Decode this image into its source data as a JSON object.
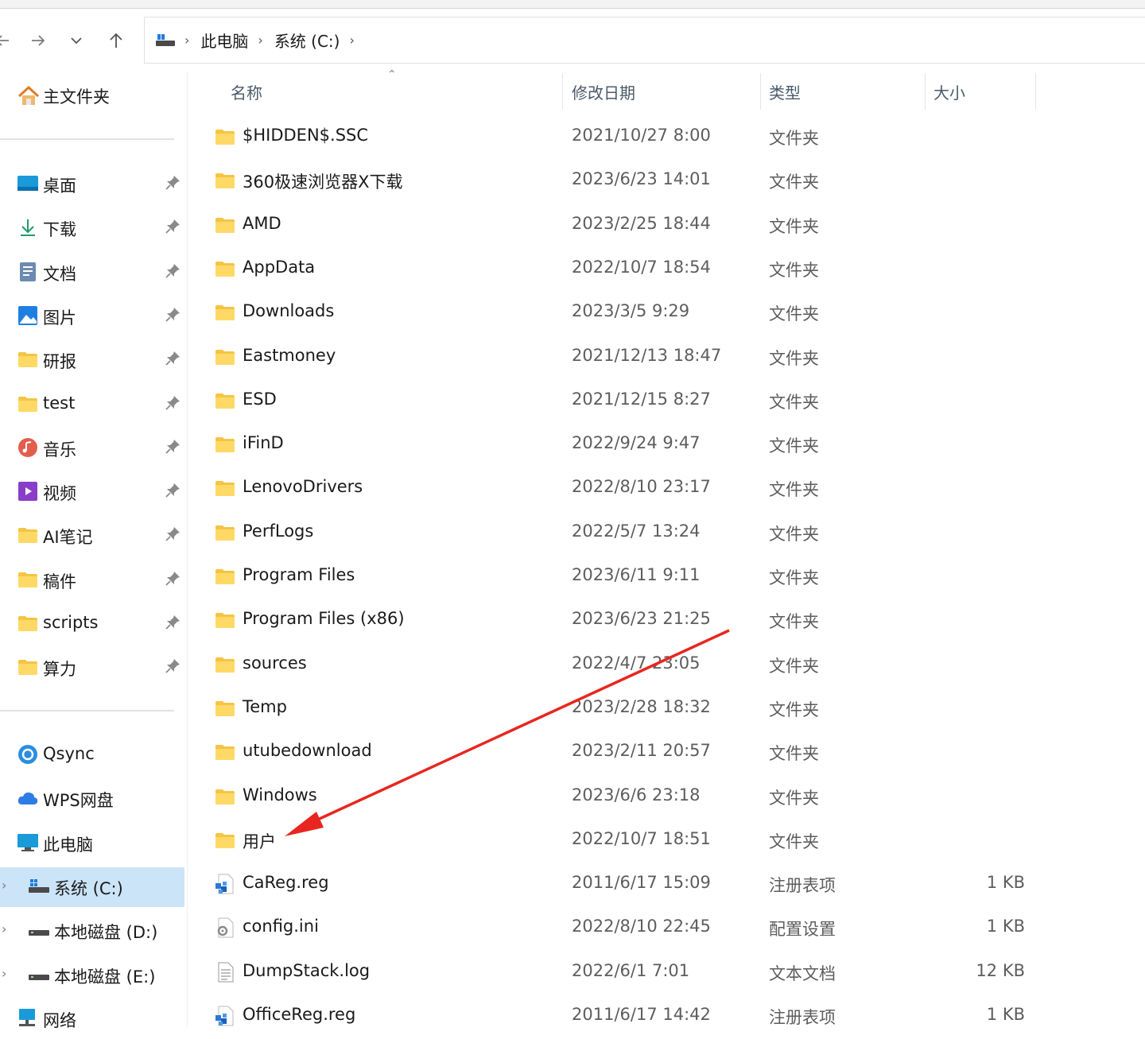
{
  "breadcrumb": [
    "此电脑",
    "系统 (C:)"
  ],
  "columns": {
    "name": "名称",
    "date": "修改日期",
    "type": "类型",
    "size": "大小"
  },
  "sidebar": {
    "home": "主文件夹",
    "pinned": [
      {
        "label": "桌面",
        "icon": "desktop-icon"
      },
      {
        "label": "下载",
        "icon": "download-icon"
      },
      {
        "label": "文档",
        "icon": "document-icon"
      },
      {
        "label": "图片",
        "icon": "pictures-icon"
      },
      {
        "label": "研报",
        "icon": "folder-icon"
      },
      {
        "label": "test",
        "icon": "folder-icon"
      },
      {
        "label": "音乐",
        "icon": "music-icon"
      },
      {
        "label": "视频",
        "icon": "video-icon"
      },
      {
        "label": "AI笔记",
        "icon": "folder-icon"
      },
      {
        "label": "稿件",
        "icon": "folder-icon"
      },
      {
        "label": "scripts",
        "icon": "folder-icon"
      },
      {
        "label": "算力",
        "icon": "folder-icon"
      }
    ],
    "locations": [
      {
        "label": "Qsync",
        "icon": "qsync-icon"
      },
      {
        "label": "WPS网盘",
        "icon": "cloud-icon"
      },
      {
        "label": "此电脑",
        "icon": "computer-icon"
      },
      {
        "label": "系统 (C:)",
        "icon": "drive-c-icon",
        "selected": true
      },
      {
        "label": "本地磁盘 (D:)",
        "icon": "drive-icon"
      },
      {
        "label": "本地磁盘 (E:)",
        "icon": "drive-icon"
      },
      {
        "label": "网络",
        "icon": "network-icon"
      }
    ]
  },
  "files": [
    {
      "name": "$HIDDEN$.SSC",
      "date": "2021/10/27 8:00",
      "type": "文件夹",
      "size": "",
      "icon": "folder"
    },
    {
      "name": "360极速浏览器X下载",
      "date": "2023/6/23 14:01",
      "type": "文件夹",
      "size": "",
      "icon": "folder"
    },
    {
      "name": "AMD",
      "date": "2023/2/25 18:44",
      "type": "文件夹",
      "size": "",
      "icon": "folder"
    },
    {
      "name": "AppData",
      "date": "2022/10/7 18:54",
      "type": "文件夹",
      "size": "",
      "icon": "folder"
    },
    {
      "name": "Downloads",
      "date": "2023/3/5 9:29",
      "type": "文件夹",
      "size": "",
      "icon": "folder"
    },
    {
      "name": "Eastmoney",
      "date": "2021/12/13 18:47",
      "type": "文件夹",
      "size": "",
      "icon": "folder"
    },
    {
      "name": "ESD",
      "date": "2021/12/15 8:27",
      "type": "文件夹",
      "size": "",
      "icon": "folder"
    },
    {
      "name": "iFinD",
      "date": "2022/9/24 9:47",
      "type": "文件夹",
      "size": "",
      "icon": "folder"
    },
    {
      "name": "LenovoDrivers",
      "date": "2022/8/10 23:17",
      "type": "文件夹",
      "size": "",
      "icon": "folder"
    },
    {
      "name": "PerfLogs",
      "date": "2022/5/7 13:24",
      "type": "文件夹",
      "size": "",
      "icon": "folder"
    },
    {
      "name": "Program Files",
      "date": "2023/6/11 9:11",
      "type": "文件夹",
      "size": "",
      "icon": "folder"
    },
    {
      "name": "Program Files (x86)",
      "date": "2023/6/23 21:25",
      "type": "文件夹",
      "size": "",
      "icon": "folder"
    },
    {
      "name": "sources",
      "date": "2022/4/7 23:05",
      "type": "文件夹",
      "size": "",
      "icon": "folder"
    },
    {
      "name": "Temp",
      "date": "2023/2/28 18:32",
      "type": "文件夹",
      "size": "",
      "icon": "folder"
    },
    {
      "name": "utubedownload",
      "date": "2023/2/11 20:57",
      "type": "文件夹",
      "size": "",
      "icon": "folder"
    },
    {
      "name": "Windows",
      "date": "2023/6/6 23:18",
      "type": "文件夹",
      "size": "",
      "icon": "folder"
    },
    {
      "name": "用户",
      "date": "2022/10/7 18:51",
      "type": "文件夹",
      "size": "",
      "icon": "folder"
    },
    {
      "name": "CaReg.reg",
      "date": "2011/6/17 15:09",
      "type": "注册表项",
      "size": "1 KB",
      "icon": "reg"
    },
    {
      "name": "config.ini",
      "date": "2022/8/10 22:45",
      "type": "配置设置",
      "size": "1 KB",
      "icon": "ini"
    },
    {
      "name": "DumpStack.log",
      "date": "2022/6/1 7:01",
      "type": "文本文档",
      "size": "12 KB",
      "icon": "txt"
    },
    {
      "name": "OfficeReg.reg",
      "date": "2011/6/17 14:42",
      "type": "注册表项",
      "size": "1 KB",
      "icon": "reg"
    }
  ],
  "annotation": {
    "color": "#e8261f"
  }
}
